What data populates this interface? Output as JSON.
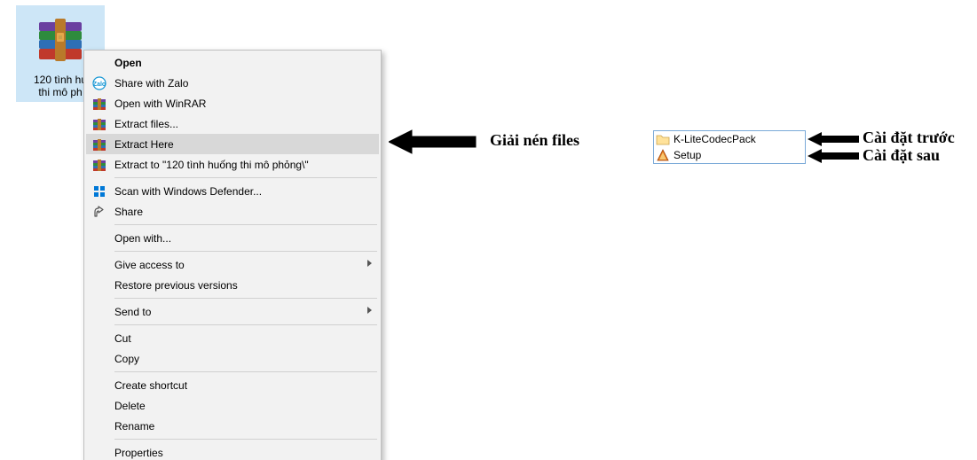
{
  "desktop_icon": {
    "caption_line1": "120 tình hu",
    "caption_line2": "thi mô ph"
  },
  "context_menu": {
    "items": [
      {
        "label": "Open",
        "bold": true
      },
      {
        "label": "Share with Zalo",
        "icon": "zalo"
      },
      {
        "label": "Open with WinRAR",
        "icon": "rar"
      },
      {
        "label": "Extract files...",
        "icon": "rar"
      },
      {
        "label": "Extract Here",
        "icon": "rar",
        "highlight": true
      },
      {
        "label": "Extract to \"120 tình huống thi mô phỏng\\\"",
        "icon": "rar"
      },
      {
        "sep": true
      },
      {
        "label": "Scan with Windows Defender...",
        "icon": "defender"
      },
      {
        "label": "Share",
        "icon": "share"
      },
      {
        "sep": true
      },
      {
        "label": "Open with..."
      },
      {
        "sep": true
      },
      {
        "label": "Give access to",
        "submenu": true
      },
      {
        "label": "Restore previous versions"
      },
      {
        "sep": true
      },
      {
        "label": "Send to",
        "submenu": true
      },
      {
        "sep": true
      },
      {
        "label": "Cut"
      },
      {
        "label": "Copy"
      },
      {
        "sep": true
      },
      {
        "label": "Create shortcut"
      },
      {
        "label": "Delete"
      },
      {
        "label": "Rename"
      },
      {
        "sep": true
      },
      {
        "label": "Properties"
      }
    ]
  },
  "annotations": {
    "extract_label": "Giải nén files",
    "folder_label": "Cài đặt trước",
    "setup_label": "Cài đặt sau"
  },
  "file_list": {
    "rows": [
      {
        "name": "K-LiteCodecPack",
        "type": "folder"
      },
      {
        "name": "Setup",
        "type": "app"
      }
    ]
  }
}
